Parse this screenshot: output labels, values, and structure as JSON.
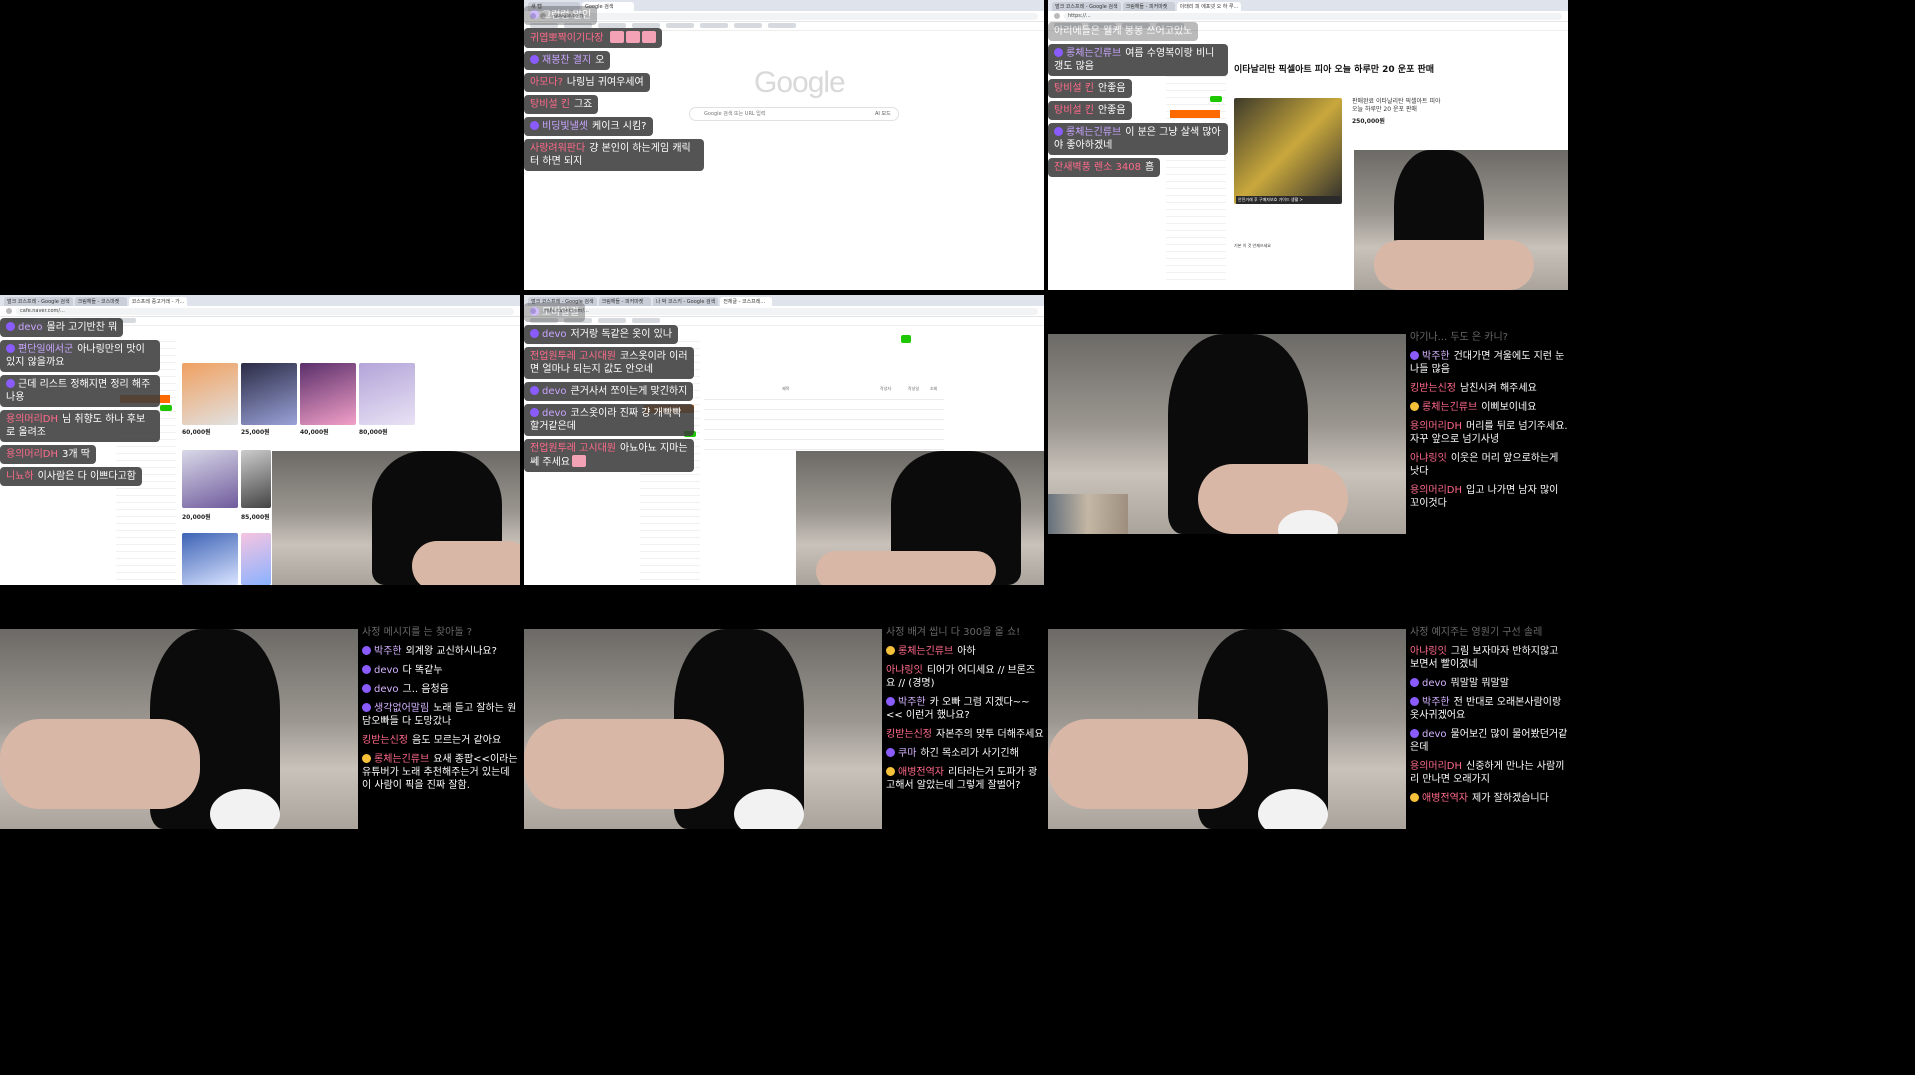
{
  "browser": {
    "tabs_top_middle": [
      "새 탭",
      "Google 검색"
    ],
    "tabs_top_right": [
      "벌크 코스프레 - Google 검색",
      "크림해들 - 피커마켓",
      "이태리 피 에포넷 오 하 루..."
    ],
    "tabs_mid_left": [
      "벌크 코스프레 - Google 검색",
      "크림해들 - 코스마켓",
      "코스프레 중고거래 - 가..."
    ],
    "tabs_mid_middle": [
      "벌크 코스프레 - Google 검색",
      "크림해들 - 피커마켓",
      "나 박 코스키 - Google 검색",
      "전체글 - 코스프레..."
    ],
    "url_top_middle": "google.com",
    "url_top_right": "https://...",
    "url_mid_left": "cafe.naver.com/...",
    "url_mid_middle": "cafe.naver.com/..."
  },
  "google": {
    "logo": "Google",
    "search_placeholder": "Google 검색 또는 URL 입력",
    "ai_mode": "AI 모드"
  },
  "product": {
    "title": "이타날리탄 픽셀아트 피아 오늘 하루만 20 운포 판매",
    "price": "250,000원",
    "side_title": "판매완료 이타날리탄 픽셀아트 피아 오늘 하루만 20 운포 판매",
    "banner": "안전거래 후 구매자보호 가이드 생활 >",
    "notice": "기본 이 것 안제쓰세요"
  },
  "shop_grid": {
    "prices": [
      "60,000원",
      "25,000원",
      "40,000원",
      "80,000원",
      "20,000원",
      "85,000원"
    ]
  },
  "board": {
    "header_cols": [
      "제목",
      "작성자",
      "작성일",
      "조회"
    ]
  },
  "chat_r1_left": [
    {
      "badge": "purple",
      "nick": "",
      "text": "그런런 말인",
      "faded": true
    },
    {
      "badge": "",
      "nick": "귀엽뽀짝이기다장",
      "text": "",
      "emotes": 3
    },
    {
      "badge": "purple",
      "nick": "재봉찬 결지",
      "text": "오"
    },
    {
      "badge": "",
      "nick": "아모다?",
      "text": "나링님 귀여우세여"
    },
    {
      "badge": "",
      "nick": "탕비설 킨",
      "text": "그죠"
    },
    {
      "badge": "purple",
      "nick": "비딩빛낼셋",
      "text": "케이크 시킴?"
    },
    {
      "badge": "",
      "nick": "사랑려워판다",
      "text": "걍 본인이 하는게임 캐릭터 하면 되지"
    }
  ],
  "chat_r1_right": [
    {
      "badge": "",
      "nick": "",
      "text": "아리에들은 웰케 봉봉 쓰어고있노",
      "faded": true
    },
    {
      "badge": "purple",
      "nick": "롱체는긴류브",
      "text": "여름 수영복이랑 비니갱도 많음"
    },
    {
      "badge": "",
      "nick": "탕비설 킨",
      "text": "안좋음"
    },
    {
      "badge": "",
      "nick": "탕비설 킨",
      "text": "안좋음"
    },
    {
      "badge": "purple",
      "nick": "롱체는긴류브",
      "text": "이 분은 그냥 살색 많아야 좋아하겠네"
    },
    {
      "badge": "",
      "nick": "잔새벽풍 렌소 3408",
      "text": "흠"
    }
  ],
  "chat_r2_left": [
    {
      "badge": "purple",
      "nick": "devo",
      "text": "몰라 고기반찬 뭐"
    },
    {
      "badge": "purple",
      "nick": "편단일에서군",
      "text": "아나링만의 맛이 있지 않을까요"
    },
    {
      "badge": "purple",
      "nick": "",
      "text": "근데 리스트 정해지면 정리 해주나용"
    },
    {
      "badge": "",
      "nick": "용의머리DH",
      "text": "님 취향도 하나 후보로 올려조"
    },
    {
      "badge": "",
      "nick": "용의머리DH",
      "text": "3개 딱"
    },
    {
      "badge": "",
      "nick": "니뇨하",
      "text": "이사람은 다 이쁘다고함"
    }
  ],
  "chat_r2_middle": [
    {
      "badge": "purple",
      "nick": "",
      "text": "모바일결",
      "faded": true
    },
    {
      "badge": "purple",
      "nick": "devo",
      "text": "저거랑 독같은 옷이 있나"
    },
    {
      "badge": "",
      "nick": "전업원투레 고시대원",
      "text": "코스옷이라 이러면 얼마나 되는지 값도 안오네"
    },
    {
      "badge": "purple",
      "nick": "devo",
      "text": "큰거사서 쪼이는게 맞긴하지"
    },
    {
      "badge": "purple",
      "nick": "devo",
      "text": "코스옷이라 진짜 걍 개빡빡할거같은데"
    },
    {
      "badge": "",
      "nick": "전업원투레 고시대원",
      "text": "아뇨아뇨 지마는 쎄 주세요",
      "emotes": 1
    }
  ],
  "chat_r2_right": [
    {
      "badge": "",
      "nick": "",
      "text": "아기나... 두도 은 카니?",
      "faded": true
    },
    {
      "badge": "purple",
      "nick": "박주한",
      "text": "건대가면 겨울에도 지런 눈나들 많음"
    },
    {
      "badge": "",
      "nick": "킹받는신정",
      "text": "남친시켜 해주세요"
    },
    {
      "badge": "gold",
      "nick": "롱체는긴류브",
      "text": "이삐보이네요"
    },
    {
      "badge": "",
      "nick": "용의머리DH",
      "text": "머리를 뒤로 넘기주세요. 자꾸 앞으로 넘기사녕"
    },
    {
      "badge": "",
      "nick": "아냐링잇",
      "text": "이웃은 머리 앞으로하는게 낫다"
    },
    {
      "badge": "",
      "nick": "용의머리DH",
      "text": "입고 나가면 남자 많이 꼬이것다"
    }
  ],
  "chat_r3_left": [
    {
      "badge": "",
      "nick": "",
      "text": "사정 메시지를 는 찾아돌 ?",
      "faded": true
    },
    {
      "badge": "purple",
      "nick": "박주한",
      "text": "외계왕 교신하시나요?"
    },
    {
      "badge": "purple",
      "nick": "devo",
      "text": "다 똑같누"
    },
    {
      "badge": "purple",
      "nick": "devo",
      "text": "그.. 음청음"
    },
    {
      "badge": "purple",
      "nick": "생각없어말림",
      "text": "노래 듣고 잘하는 원담오빠들 다 도망갔나"
    },
    {
      "badge": "",
      "nick": "킹받는신정",
      "text": "음도 모르는거 같아요"
    },
    {
      "badge": "gold",
      "nick": "롱체는긴류브",
      "text": "요새 종팝<<이라는 유튜버가 노래 추천해주는거 있는데 이 사람이 픽을 진짜 잘함."
    }
  ],
  "chat_r3_middle": [
    {
      "badge": "",
      "nick": "",
      "text": "사정 배겨 씹니 다 300을 올 쇼!",
      "faded": true
    },
    {
      "badge": "gold",
      "nick": "롱체는긴류브",
      "text": "아하"
    },
    {
      "badge": "",
      "nick": "아냐링잇",
      "text": "티어가 어디세요 // 브론즈요 // (경명)"
    },
    {
      "badge": "purple",
      "nick": "박주한",
      "text": "카 오빠 그렴 지겠다~~ << 이런거 했나요?"
    },
    {
      "badge": "",
      "nick": "킹받는신정",
      "text": "자본주의 맞투 더해주세요"
    },
    {
      "badge": "purple",
      "nick": "쿠마",
      "text": "하긴 목소리가 사기긴해"
    },
    {
      "badge": "gold",
      "nick": "애병전역자",
      "text": "리타라는거 도파가 광고해서 알았는데 그렇게 잘벌어?"
    }
  ],
  "chat_r3_right": [
    {
      "badge": "",
      "nick": "",
      "text": "사정 예지주는 영원기 구선 솔레",
      "faded": true
    },
    {
      "badge": "",
      "nick": "아냐링잇",
      "text": "그림 보자마자 반하지않고 보면서 빨이겠네"
    },
    {
      "badge": "purple",
      "nick": "devo",
      "text": "뭐말말 뭐말말"
    },
    {
      "badge": "purple",
      "nick": "박주한",
      "text": "전 반대로 오래본사람이랑 옷사귀겠어요"
    },
    {
      "badge": "purple",
      "nick": "devo",
      "text": "물어보긴 많이 물어봤던거같은데"
    },
    {
      "badge": "",
      "nick": "용의머리DH",
      "text": "신중하게 만나는 사람끼리 만나면 오래가지"
    },
    {
      "badge": "gold",
      "nick": "애병전역자",
      "text": "제가 잘하겠습니다"
    }
  ],
  "colors": {
    "nick_pink": "#ff6a8a",
    "nick_purple": "#d5b3ff",
    "bubble_bg": "#3c3c3c",
    "naver_green": "#1ec800",
    "accent_orange": "#ff6a00"
  }
}
